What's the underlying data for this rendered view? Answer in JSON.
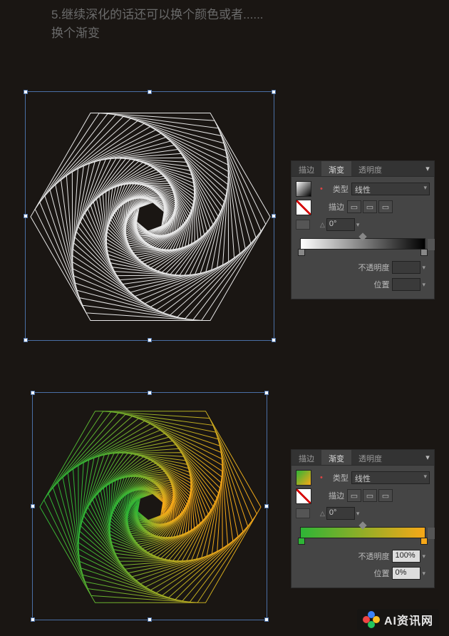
{
  "header": {
    "line1": "5.继续深化的话还可以换个颜色或者......",
    "line2": "换个渐变"
  },
  "panel1": {
    "tabs": {
      "stroke": "描边",
      "gradient": "渐变",
      "transparency": "透明度"
    },
    "type_label": "类型",
    "type_value": "线性",
    "stroke_label": "描边",
    "angle_value": "0°",
    "opacity_label": "不透明度",
    "opacity_value": "",
    "location_label": "位置",
    "location_value": ""
  },
  "panel2": {
    "tabs": {
      "stroke": "描边",
      "gradient": "渐变",
      "transparency": "透明度"
    },
    "type_label": "类型",
    "type_value": "线性",
    "stroke_label": "描边",
    "angle_value": "0°",
    "opacity_label": "不透明度",
    "opacity_value": "100%",
    "location_label": "位置",
    "location_value": "0%"
  },
  "watermark": "AI资讯网",
  "chart_data": [
    {
      "type": "gradient",
      "direction": "linear-horizontal",
      "stops": [
        {
          "position": 0,
          "color": "#ffffff"
        },
        {
          "position": 100,
          "color": "#000000"
        }
      ]
    },
    {
      "type": "gradient",
      "direction": "linear-horizontal",
      "stops": [
        {
          "position": 0,
          "color": "#2eb536"
        },
        {
          "position": 100,
          "color": "#f7a818"
        }
      ]
    }
  ]
}
